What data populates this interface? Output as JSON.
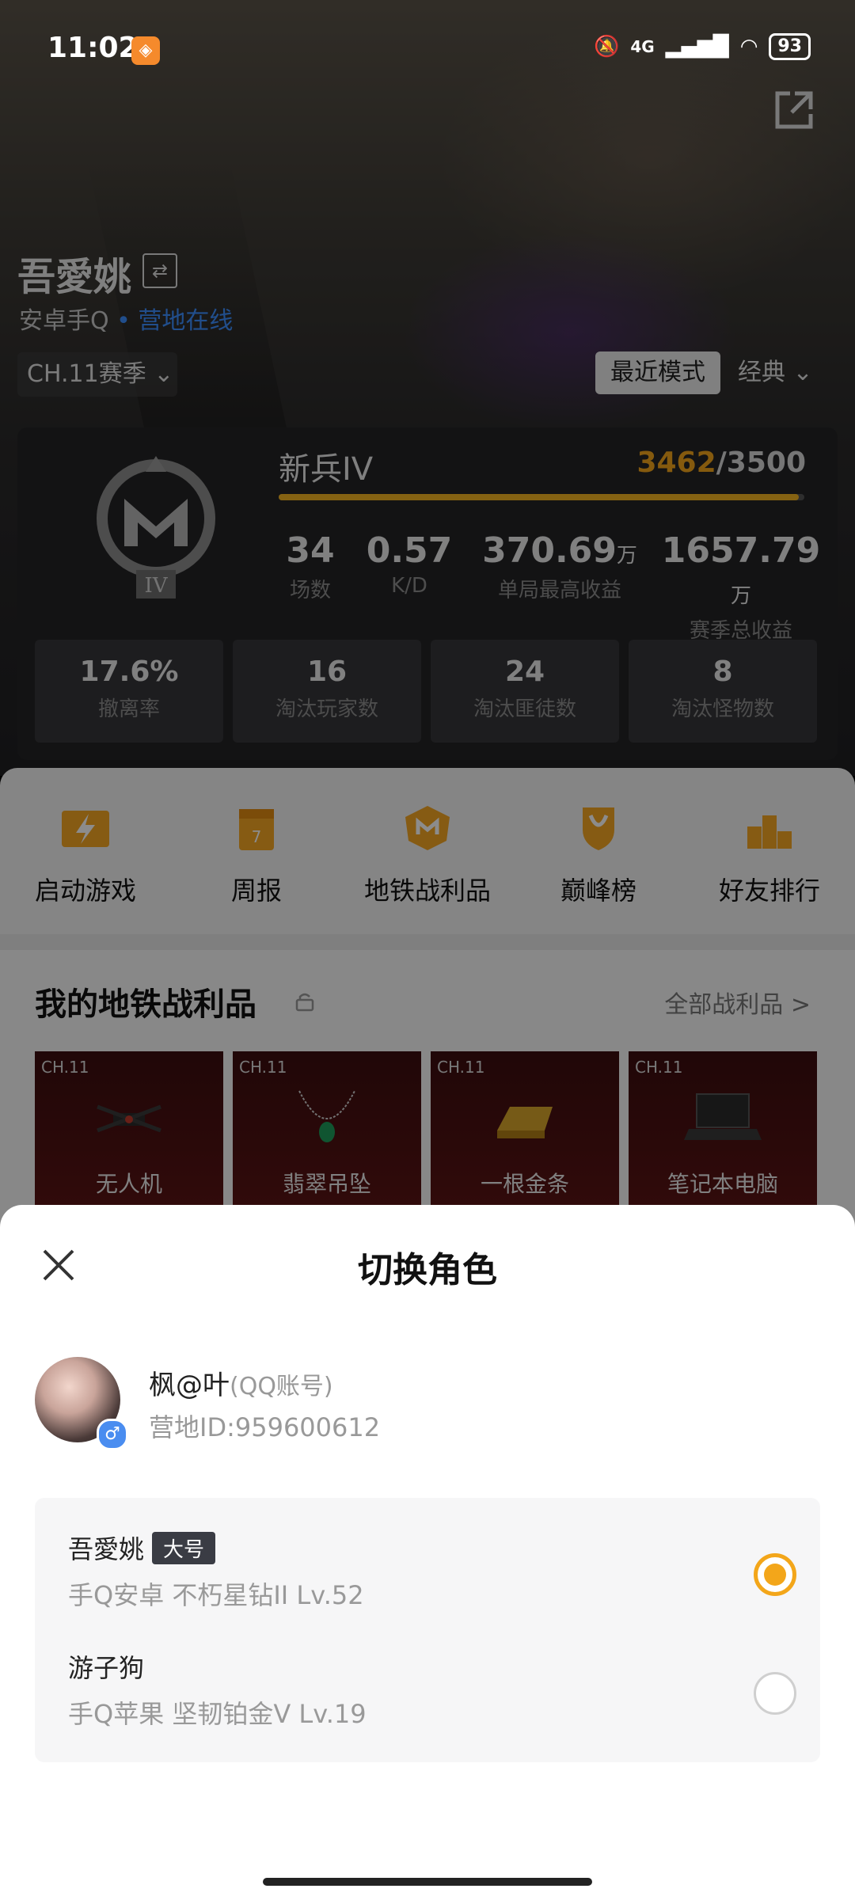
{
  "status_bar": {
    "time": "11:02",
    "network": "4G",
    "battery": "93"
  },
  "profile": {
    "name": "吾愛姚",
    "platform": "安卓手Q",
    "status": "营地在线",
    "season": "CH.11赛季",
    "mode_recent": "最近模式",
    "mode_select": "经典"
  },
  "rank": {
    "name": "新兵IV",
    "level_roman": "IV",
    "score_current": "3462",
    "score_total": "/3500",
    "progress": 0.989
  },
  "stats": [
    {
      "value": "34",
      "unit": "",
      "label": "场数"
    },
    {
      "value": "0.57",
      "unit": "",
      "label": "K/D"
    },
    {
      "value": "370.69",
      "unit": "万",
      "label": "单局最高收益"
    },
    {
      "value": "1657.79",
      "unit": "万",
      "label": "赛季总收益"
    }
  ],
  "cells": [
    {
      "value": "17.6%",
      "label": "撤离率"
    },
    {
      "value": "16",
      "label": "淘汰玩家数"
    },
    {
      "value": "24",
      "label": "淘汰匪徒数"
    },
    {
      "value": "8",
      "label": "淘汰怪物数"
    }
  ],
  "actions": [
    {
      "label": "启动游戏",
      "icon": "lightning-icon"
    },
    {
      "label": "周报",
      "icon": "calendar-icon",
      "badge": "7"
    },
    {
      "label": "地铁战利品",
      "icon": "metro-badge-icon"
    },
    {
      "label": "巅峰榜",
      "icon": "trophy-shield-icon"
    },
    {
      "label": "好友排行",
      "icon": "podium-icon"
    }
  ],
  "loot": {
    "title": "我的地铁战利品",
    "all_label": "全部战利品 >",
    "items": [
      {
        "tag": "CH.11",
        "name": "无人机"
      },
      {
        "tag": "CH.11",
        "name": "翡翠吊坠"
      },
      {
        "tag": "CH.11",
        "name": "一根金条"
      },
      {
        "tag": "CH.11",
        "name": "笔记本电脑"
      }
    ]
  },
  "sheet": {
    "title": "切换角色",
    "account_name": "枫@叶",
    "account_type": "(QQ账号)",
    "account_id": "营地ID:959600612",
    "gender": "♂",
    "roles": [
      {
        "name": "吾愛姚",
        "tag": "大号",
        "info": "手Q安卓  不朽星钻II  Lv.52",
        "selected": true
      },
      {
        "name": "游子狗",
        "tag": "",
        "info": "手Q苹果  坚韧铂金V  Lv.19",
        "selected": false
      }
    ]
  },
  "colors": {
    "accent": "#f3a61a",
    "online": "#3c8fff"
  }
}
